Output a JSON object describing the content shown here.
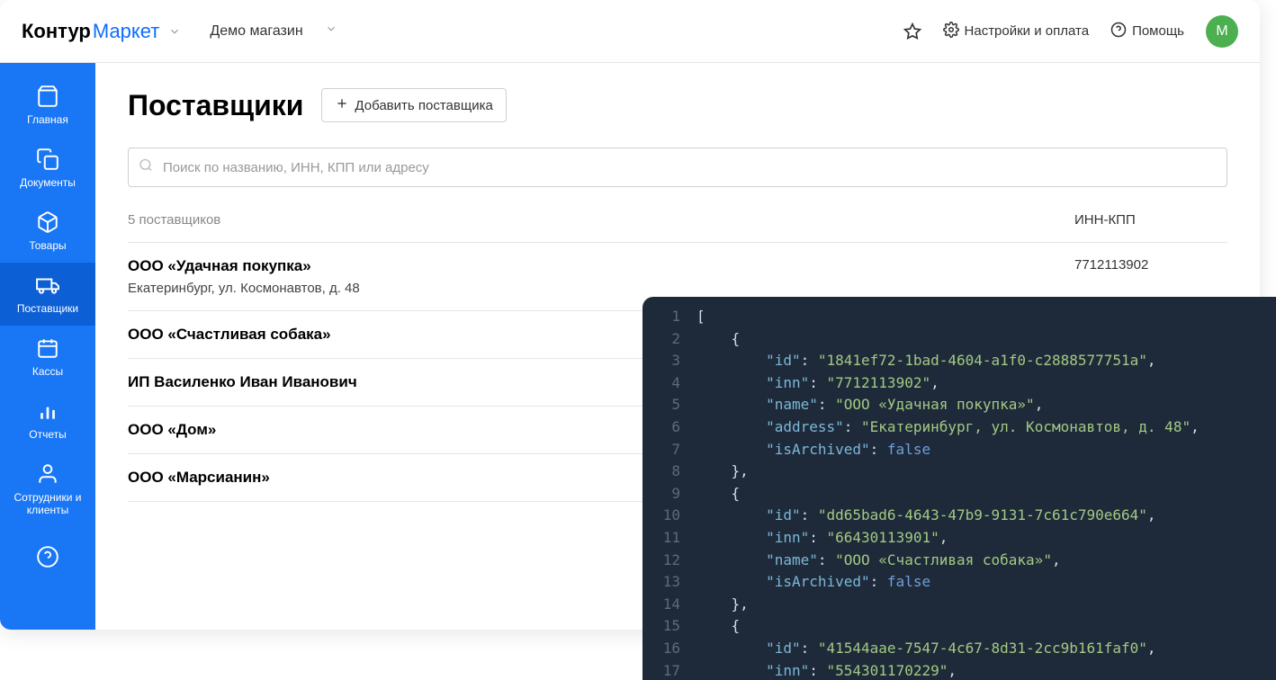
{
  "header": {
    "logo_kontur": "Контур",
    "logo_market": "Маркет",
    "shop_name": "Демо магазин",
    "settings_label": "Настройки и оплата",
    "help_label": "Помощь",
    "avatar_letter": "М"
  },
  "sidebar": {
    "items": [
      {
        "label": "Главная"
      },
      {
        "label": "Документы"
      },
      {
        "label": "Товары"
      },
      {
        "label": "Поставщики"
      },
      {
        "label": "Кассы"
      },
      {
        "label": "Отчеты"
      },
      {
        "label": "Сотрудники и клиенты"
      }
    ]
  },
  "page": {
    "title": "Поставщики",
    "add_button_label": "Добавить поставщика",
    "search_placeholder": "Поиск по названию, ИНН, КПП или адресу"
  },
  "table": {
    "count_label": "5 поставщиков",
    "inn_col_label": "ИНН-КПП",
    "rows": [
      {
        "name": "ООО «Удачная покупка»",
        "address": "Екатеринбург, ул. Космонавтов, д. 48",
        "inn": "7712113902"
      },
      {
        "name": "ООО «Счастливая собака»",
        "address": "",
        "inn": ""
      },
      {
        "name": "ИП Василенко Иван Иванович",
        "address": "",
        "inn": ""
      },
      {
        "name": "ООО «Дом»",
        "address": "",
        "inn": ""
      },
      {
        "name": "ООО «Марсианин»",
        "address": "",
        "inn": ""
      }
    ]
  },
  "code": {
    "lines": [
      [
        {
          "t": "punc",
          "v": "["
        }
      ],
      [
        {
          "t": "punc",
          "v": "    {"
        }
      ],
      [
        {
          "t": "punc",
          "v": "        "
        },
        {
          "t": "key",
          "v": "\"id\""
        },
        {
          "t": "punc",
          "v": ": "
        },
        {
          "t": "str",
          "v": "\"1841ef72-1bad-4604-a1f0-c2888577751a\""
        },
        {
          "t": "punc",
          "v": ","
        }
      ],
      [
        {
          "t": "punc",
          "v": "        "
        },
        {
          "t": "key",
          "v": "\"inn\""
        },
        {
          "t": "punc",
          "v": ": "
        },
        {
          "t": "str",
          "v": "\"7712113902\""
        },
        {
          "t": "punc",
          "v": ","
        }
      ],
      [
        {
          "t": "punc",
          "v": "        "
        },
        {
          "t": "key",
          "v": "\"name\""
        },
        {
          "t": "punc",
          "v": ": "
        },
        {
          "t": "str",
          "v": "\"ООО «Удачная покупка»\""
        },
        {
          "t": "punc",
          "v": ","
        }
      ],
      [
        {
          "t": "punc",
          "v": "        "
        },
        {
          "t": "key",
          "v": "\"address\""
        },
        {
          "t": "punc",
          "v": ": "
        },
        {
          "t": "str",
          "v": "\"Екатеринбург, ул. Космонавтов, д. 48\""
        },
        {
          "t": "punc",
          "v": ","
        }
      ],
      [
        {
          "t": "punc",
          "v": "        "
        },
        {
          "t": "key",
          "v": "\"isArchived\""
        },
        {
          "t": "punc",
          "v": ": "
        },
        {
          "t": "bool",
          "v": "false"
        }
      ],
      [
        {
          "t": "punc",
          "v": "    },"
        }
      ],
      [
        {
          "t": "punc",
          "v": "    {"
        }
      ],
      [
        {
          "t": "punc",
          "v": "        "
        },
        {
          "t": "key",
          "v": "\"id\""
        },
        {
          "t": "punc",
          "v": ": "
        },
        {
          "t": "str",
          "v": "\"dd65bad6-4643-47b9-9131-7c61c790e664\""
        },
        {
          "t": "punc",
          "v": ","
        }
      ],
      [
        {
          "t": "punc",
          "v": "        "
        },
        {
          "t": "key",
          "v": "\"inn\""
        },
        {
          "t": "punc",
          "v": ": "
        },
        {
          "t": "str",
          "v": "\"66430113901\""
        },
        {
          "t": "punc",
          "v": ","
        }
      ],
      [
        {
          "t": "punc",
          "v": "        "
        },
        {
          "t": "key",
          "v": "\"name\""
        },
        {
          "t": "punc",
          "v": ": "
        },
        {
          "t": "str",
          "v": "\"ООО «Счастливая собака»\""
        },
        {
          "t": "punc",
          "v": ","
        }
      ],
      [
        {
          "t": "punc",
          "v": "        "
        },
        {
          "t": "key",
          "v": "\"isArchived\""
        },
        {
          "t": "punc",
          "v": ": "
        },
        {
          "t": "bool",
          "v": "false"
        }
      ],
      [
        {
          "t": "punc",
          "v": "    },"
        }
      ],
      [
        {
          "t": "punc",
          "v": "    {"
        }
      ],
      [
        {
          "t": "punc",
          "v": "        "
        },
        {
          "t": "key",
          "v": "\"id\""
        },
        {
          "t": "punc",
          "v": ": "
        },
        {
          "t": "str",
          "v": "\"41544aae-7547-4c67-8d31-2cc9b161faf0\""
        },
        {
          "t": "punc",
          "v": ","
        }
      ],
      [
        {
          "t": "punc",
          "v": "        "
        },
        {
          "t": "key",
          "v": "\"inn\""
        },
        {
          "t": "punc",
          "v": ": "
        },
        {
          "t": "str",
          "v": "\"554301170229\""
        },
        {
          "t": "punc",
          "v": ","
        }
      ]
    ]
  }
}
